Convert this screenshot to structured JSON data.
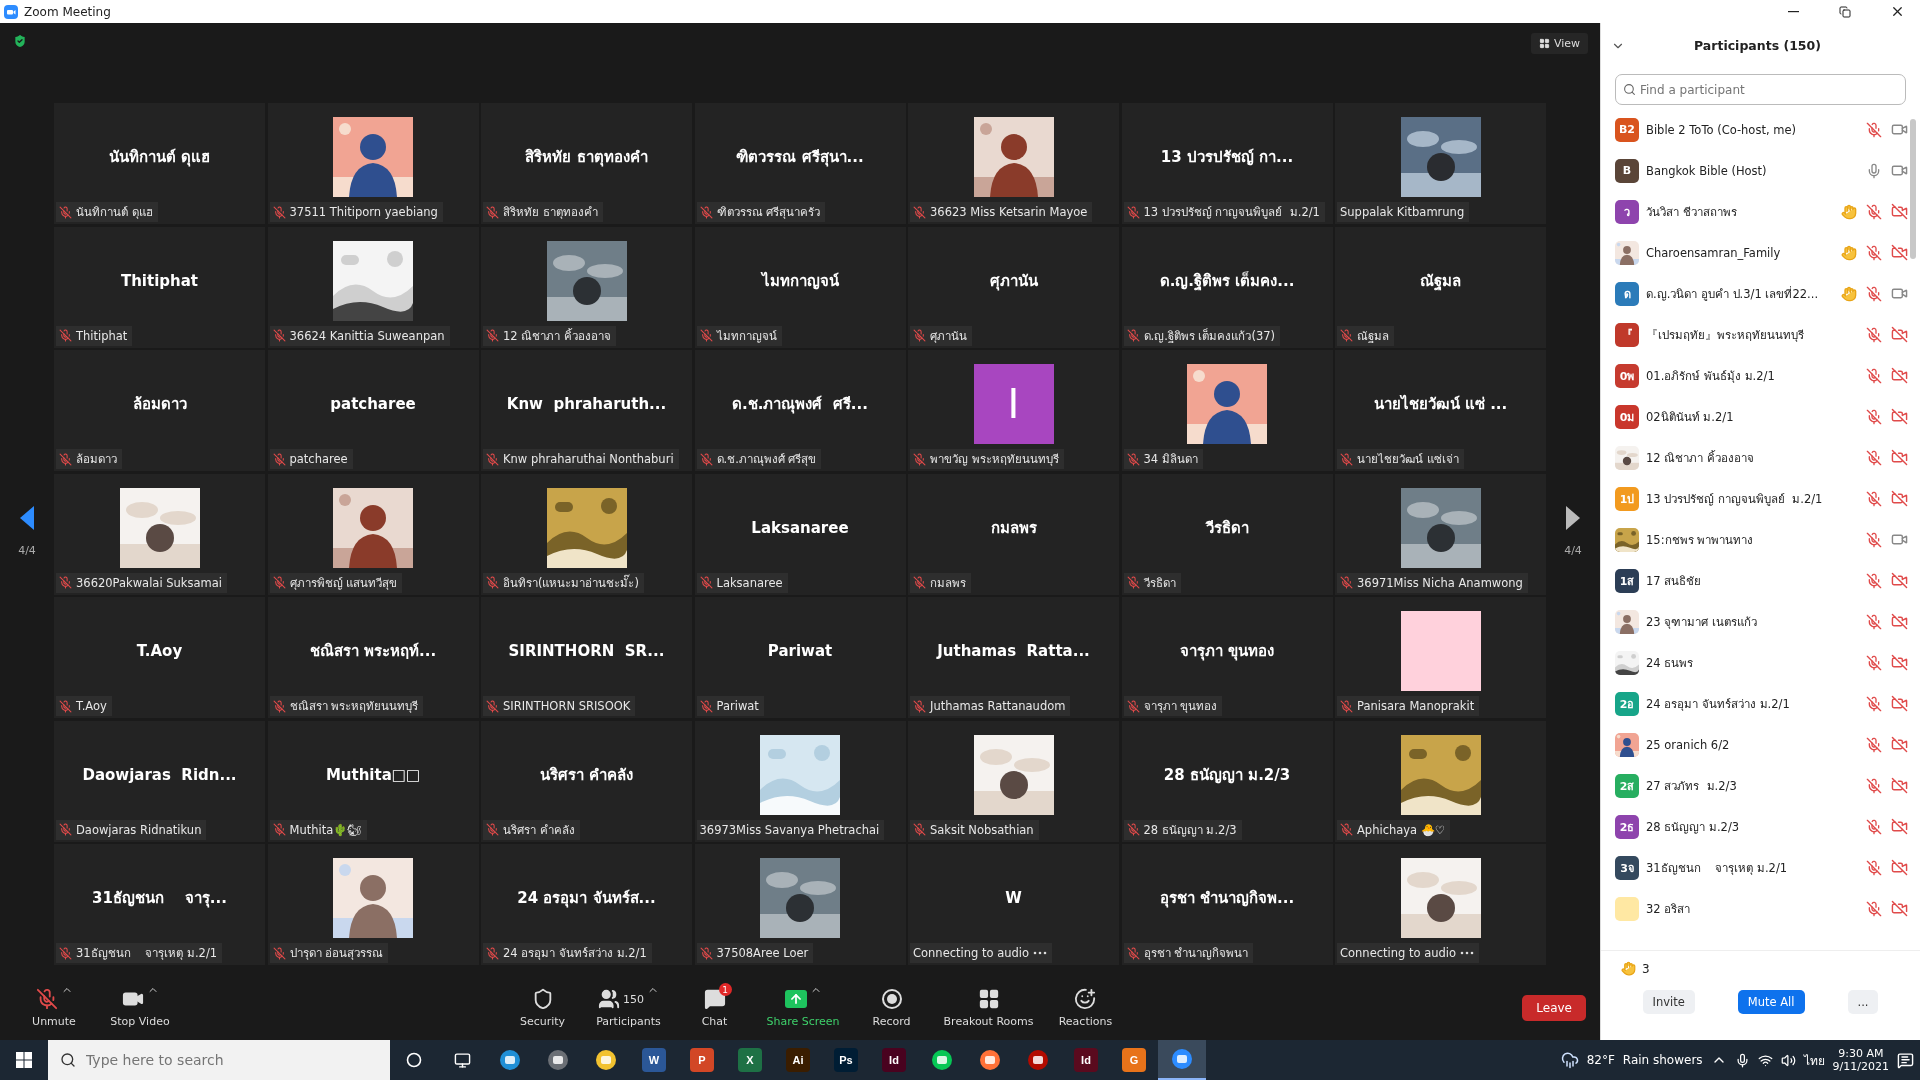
{
  "window": {
    "title": "Zoom Meeting"
  },
  "view_button": {
    "label": "View"
  },
  "pager": {
    "left": "4/4",
    "right": "4/4"
  },
  "tiles": [
    {
      "kind": "name",
      "title": "นันทิกานต์ ดุแฮ",
      "name": "นันทิกานต์ ดุแฮ",
      "muted": true,
      "connecting": false
    },
    {
      "kind": "picture",
      "name": "37511 Thitiporn yaebiang",
      "muted": true,
      "connecting": false
    },
    {
      "kind": "name",
      "title": "สิริหทัย ธาตุทองคำ",
      "name": "สิริหทัย ธาตุทองคำ",
      "muted": true,
      "connecting": false
    },
    {
      "kind": "name",
      "title": "ฑิตวรรณ ศรีสุนา...",
      "name": "ฑิตวรรณ ศรีสุนาครัว",
      "muted": true,
      "connecting": false
    },
    {
      "kind": "picture",
      "name": "36623 Miss Ketsarin Mayoe",
      "muted": true,
      "connecting": false
    },
    {
      "kind": "name",
      "title": "13 ปวรปรัชญ์ กา...",
      "name": "13 ปวรปรัชญ์ กาญจนพิบูลย์  ม.2/1",
      "muted": true,
      "connecting": false
    },
    {
      "kind": "picture",
      "name": "Suppalak Kitbamrung",
      "muted": false,
      "connecting": false
    },
    {
      "kind": "name",
      "title": "Thitiphat",
      "name": "Thitiphat",
      "muted": true,
      "connecting": false
    },
    {
      "kind": "picture",
      "name": "36624 Kanittia Suweanpan",
      "muted": true,
      "connecting": false
    },
    {
      "kind": "picture",
      "name": "12 ณิชาภา คิ้วองอาจ",
      "muted": true,
      "connecting": false
    },
    {
      "kind": "name",
      "title": "ไมทกาญจน์",
      "name": "ไมทกาญจน์",
      "muted": true,
      "connecting": false
    },
    {
      "kind": "name",
      "title": "ศุภานัน",
      "name": "ศุภานัน",
      "muted": true,
      "connecting": false
    },
    {
      "kind": "name",
      "title": "ด.ญ.ฐิติพร เต็มคง...",
      "name": "ด.ญ.ฐิติพร เต็มคงแก้ว(37)",
      "muted": true,
      "connecting": false
    },
    {
      "kind": "name",
      "title": "ณัฐมล",
      "name": "ณัฐมล",
      "muted": true,
      "connecting": false
    },
    {
      "kind": "name",
      "title": "ล้อมดาว",
      "name": "ล้อมดาว",
      "muted": true,
      "connecting": false
    },
    {
      "kind": "name",
      "title": "patcharee",
      "name": "patcharee",
      "muted": true,
      "connecting": false
    },
    {
      "kind": "name",
      "title": "Knw  phraharuth...",
      "name": "Knw phraharuthai Nonthaburi",
      "muted": true,
      "connecting": false
    },
    {
      "kind": "name",
      "title": "ด.ช.ภาณุพงศ์  ศรี...",
      "name": "ด.ช.ภาณุพงศ์ ศรีสุข",
      "muted": true,
      "connecting": false
    },
    {
      "kind": "letter",
      "letter": "I",
      "color": "#a846c0",
      "name": "พาขวัญ พระหฤทัยนนทบุรี",
      "muted": true,
      "connecting": false
    },
    {
      "kind": "picture",
      "name": "34 มิลินดา",
      "muted": true,
      "connecting": false
    },
    {
      "kind": "name",
      "title": "นายไชยวัฒน์ แซ่ ...",
      "name": "นายไชยวัฒน์ แซ่เจ่า",
      "muted": true,
      "connecting": false
    },
    {
      "kind": "picture",
      "name": "36620Pakwalai Suksamai",
      "muted": true,
      "connecting": false
    },
    {
      "kind": "picture",
      "name": "ศุภารพิชญ์ แสนทวีสุข",
      "muted": true,
      "connecting": false
    },
    {
      "kind": "picture",
      "name": "อินทิรา(แหนะมาอ่านชะมั๊ะ)",
      "muted": true,
      "connecting": false
    },
    {
      "kind": "name",
      "title": "Laksanaree",
      "name": "Laksanaree",
      "muted": true,
      "connecting": false
    },
    {
      "kind": "name",
      "title": "กมลพร",
      "name": "กมลพร",
      "muted": true,
      "connecting": false
    },
    {
      "kind": "name",
      "title": "วีรธิดา",
      "name": "วีรธิดา",
      "muted": true,
      "connecting": false
    },
    {
      "kind": "picture",
      "name": "36971Miss Nicha Anamwong",
      "muted": true,
      "connecting": false
    },
    {
      "kind": "name",
      "title": "T.Aoy",
      "name": "T.Aoy",
      "muted": true,
      "connecting": false
    },
    {
      "kind": "name",
      "title": "ชณิสรา พระหฤท์...",
      "name": "ชณิสรา พระหฤทัยนนทบุรี",
      "muted": true,
      "connecting": false
    },
    {
      "kind": "name",
      "title": "SIRINTHORN  SR...",
      "name": "SIRINTHORN SRISOOK",
      "muted": true,
      "connecting": false
    },
    {
      "kind": "name",
      "title": "Pariwat",
      "name": "Pariwat",
      "muted": true,
      "connecting": false
    },
    {
      "kind": "name",
      "title": "Juthamas  Ratta...",
      "name": "Juthamas Rattanaudom",
      "muted": true,
      "connecting": false
    },
    {
      "kind": "name",
      "title": "จารุภา ขุนทอง",
      "name": "จารุภา ขุนทอง",
      "muted": true,
      "connecting": false
    },
    {
      "kind": "color",
      "color": "#ffd1dc",
      "name": "Panisara Manoprakit",
      "muted": true,
      "connecting": false
    },
    {
      "kind": "name",
      "title": "Daowjaras  Ridn...",
      "name": "Daowjaras Ridnatikun",
      "muted": true,
      "connecting": false
    },
    {
      "kind": "name",
      "title": "Muthita□□",
      "name": "Muthita🌵🐿",
      "muted": true,
      "connecting": false
    },
    {
      "kind": "name",
      "title": "นริศรา คำคลัง",
      "name": "นริศรา คำคลัง",
      "muted": true,
      "connecting": false
    },
    {
      "kind": "picture",
      "name": "36973Miss Savanya Phetrachai",
      "muted": false,
      "connecting": false
    },
    {
      "kind": "picture",
      "name": "Saksit Nobsathian",
      "muted": true,
      "connecting": false
    },
    {
      "kind": "name",
      "title": "28 ธนัญญา ม.2/3",
      "name": "28 ธนัญญา ม.2/3",
      "muted": true,
      "connecting": false
    },
    {
      "kind": "picture",
      "name": "Aphichaya 🐣♡",
      "muted": true,
      "connecting": false
    },
    {
      "kind": "name",
      "title": "31ธัญชนก    จารุ...",
      "name": "31ธัญชนก    จารุเหตุ ม.2/1",
      "muted": true,
      "connecting": false
    },
    {
      "kind": "picture",
      "name": "ปารุดา อ่อนสุวรรณ",
      "muted": true,
      "connecting": false
    },
    {
      "kind": "name",
      "title": "24 อรอุมา จันทร์ส...",
      "name": "24 อรอุมา จันทร์สว่าง ม.2/1",
      "muted": true,
      "connecting": false
    },
    {
      "kind": "picture",
      "name": "37508Aree Loer",
      "muted": true,
      "connecting": false
    },
    {
      "kind": "name",
      "title": "W",
      "name": "Connecting to audio",
      "muted": false,
      "connecting": true
    },
    {
      "kind": "name",
      "title": "อุรชา ชำนาญกิจพ...",
      "name": "อุรชา ชำนาญกิจพนา",
      "muted": true,
      "connecting": false
    },
    {
      "kind": "picture",
      "name": "Connecting to audio",
      "muted": false,
      "connecting": true
    }
  ],
  "toolbar": {
    "items": [
      {
        "kind": "unmute",
        "label": "Unmute",
        "caret": true
      },
      {
        "kind": "video",
        "label": "Stop Video",
        "caret": true
      },
      {
        "kind": "security",
        "label": "Security",
        "caret": false
      },
      {
        "kind": "participants",
        "label": "Participants",
        "count": "150",
        "caret": true
      },
      {
        "kind": "chat",
        "label": "Chat",
        "badge": "1",
        "caret": false
      },
      {
        "kind": "share",
        "label": "Share Screen",
        "caret": true
      },
      {
        "kind": "record",
        "label": "Record",
        "caret": false
      },
      {
        "kind": "breakout",
        "label": "Breakout Rooms",
        "caret": false
      },
      {
        "kind": "reactions",
        "label": "Reactions",
        "caret": false
      }
    ],
    "leave": "Leave"
  },
  "panel": {
    "title": "Participants (150)",
    "search": {
      "placeholder": "Find a participant"
    },
    "participants": [
      {
        "avatar": {
          "kind": "initials",
          "text": "B2",
          "color": "#d9541e"
        },
        "name": "Bible 2 ToTo (Co-host, me)",
        "hand": false,
        "mic_muted": true,
        "video_off": false
      },
      {
        "avatar": {
          "kind": "initials",
          "text": "B",
          "color": "#5a4538"
        },
        "name": "Bangkok Bible (Host)",
        "hand": false,
        "mic_muted": false,
        "video_off": false
      },
      {
        "avatar": {
          "kind": "initials",
          "text": "ว",
          "color": "#8e44ad"
        },
        "name": "วันวิสา ชีวาสถาพร",
        "hand": true,
        "mic_muted": true,
        "video_off": true
      },
      {
        "name": "Charoensamran_Family",
        "hand": true,
        "mic_muted": true,
        "video_off": true
      },
      {
        "avatar": {
          "kind": "initials",
          "text": "ด",
          "color": "#2b7bb9"
        },
        "name": "ด.ญ.วนิดา อูบคำ ป.3/1 เลขที่22...",
        "hand": true,
        "mic_muted": true,
        "video_off": false
      },
      {
        "avatar": {
          "kind": "initials",
          "text": "『",
          "color": "#c0392b"
        },
        "name": "『เปรมฤทัย』พระหฤทัยนนทบุรี",
        "hand": false,
        "mic_muted": true,
        "video_off": true
      },
      {
        "avatar": {
          "kind": "initials",
          "text": "0พ",
          "color": "#c63b2f"
        },
        "name": "01.อภิรักษ์ พันธ์มุ้ง ม.2/1",
        "hand": false,
        "mic_muted": true,
        "video_off": true
      },
      {
        "avatar": {
          "kind": "initials",
          "text": "0ม",
          "color": "#c9372c"
        },
        "name": "02นิตินันท์ ม.2/1",
        "hand": false,
        "mic_muted": true,
        "video_off": true
      },
      {
        "name": "12 ณิชาภา คิ้วองอาจ",
        "hand": false,
        "mic_muted": true,
        "video_off": true
      },
      {
        "avatar": {
          "kind": "initials",
          "text": "1ป",
          "color": "#f29a1f"
        },
        "name": "13 ปวรปรัชญ์ กาญจนพิบูลย์  ม.2/1",
        "hand": false,
        "mic_muted": true,
        "video_off": true
      },
      {
        "name": "15:กชพร พาพานทาง",
        "hand": false,
        "mic_muted": true,
        "video_off": false
      },
      {
        "avatar": {
          "kind": "initials",
          "text": "1ส",
          "color": "#2c3e56"
        },
        "name": "17 สนธิชัย",
        "hand": false,
        "mic_muted": true,
        "video_off": true
      },
      {
        "name": "23 จุฑามาศ เนตรแก้ว",
        "hand": false,
        "mic_muted": true,
        "video_off": true
      },
      {
        "name": "24 ธนพร",
        "hand": false,
        "mic_muted": true,
        "video_off": true
      },
      {
        "avatar": {
          "kind": "initials",
          "text": "2อ",
          "color": "#17a589"
        },
        "name": "24 อรอุมา จันทร์สว่าง ม.2/1",
        "hand": false,
        "mic_muted": true,
        "video_off": true
      },
      {
        "name": "25 oranich 6/2",
        "hand": false,
        "mic_muted": true,
        "video_off": true
      },
      {
        "avatar": {
          "kind": "initials",
          "text": "2ส",
          "color": "#27ae60"
        },
        "name": "27 สวภัทร  ม.2/3",
        "hand": false,
        "mic_muted": true,
        "video_off": true
      },
      {
        "avatar": {
          "kind": "initials",
          "text": "2ธ",
          "color": "#8e44ad"
        },
        "name": "28 ธนัญญา ม.2/3",
        "hand": false,
        "mic_muted": true,
        "video_off": true
      },
      {
        "avatar": {
          "kind": "initials",
          "text": "3จ",
          "color": "#34495e"
        },
        "name": "31ธัญชนก    จารุเหตุ ม.2/1",
        "hand": false,
        "mic_muted": true,
        "video_off": true
      },
      {
        "avatar": {
          "kind": "color",
          "color": "#ffe8a3"
        },
        "name": "32 อริสา",
        "hand": false,
        "mic_muted": true,
        "video_off": true
      }
    ],
    "raised_hands": "3",
    "buttons": [
      "Invite",
      "Mute All",
      "..."
    ]
  },
  "taskbar": {
    "search": {
      "placeholder": "Type here to search"
    },
    "apps": [
      {
        "kind": "glyph",
        "color": "#1f8fd6",
        "selected": false
      },
      {
        "kind": "glyph",
        "color": "#6b6f75",
        "selected": false
      },
      {
        "kind": "glyph",
        "color": "#f2c230",
        "selected": false
      },
      {
        "kind": "letter",
        "label": "W",
        "color": "#2b5797",
        "selected": false
      },
      {
        "kind": "letter",
        "label": "P",
        "color": "#d24726",
        "selected": false
      },
      {
        "kind": "letter",
        "label": "X",
        "color": "#1e7145",
        "selected": false
      },
      {
        "kind": "letter",
        "label": "Ai",
        "color": "#3a1d00",
        "selected": false
      },
      {
        "kind": "letter",
        "label": "Ps",
        "color": "#001d34",
        "selected": false
      },
      {
        "kind": "letter",
        "label": "Id",
        "color": "#49021f",
        "selected": false
      },
      {
        "kind": "glyph",
        "color": "#06c755",
        "selected": false
      },
      {
        "kind": "glyph",
        "color": "#ff7139",
        "selected": false
      },
      {
        "kind": "glyph",
        "color": "#b30b00",
        "selected": false
      },
      {
        "kind": "letter",
        "label": "Id",
        "color": "#5a0a1e",
        "selected": false
      },
      {
        "kind": "letter",
        "label": "G",
        "color": "#e8731a",
        "selected": false
      },
      {
        "kind": "glyph",
        "color": "#2d8cff",
        "selected": true
      }
    ],
    "temperature": "82°F",
    "weather": "Rain showers",
    "language": "ไทย",
    "time": "9:30 AM",
    "date": "9/11/2021"
  }
}
